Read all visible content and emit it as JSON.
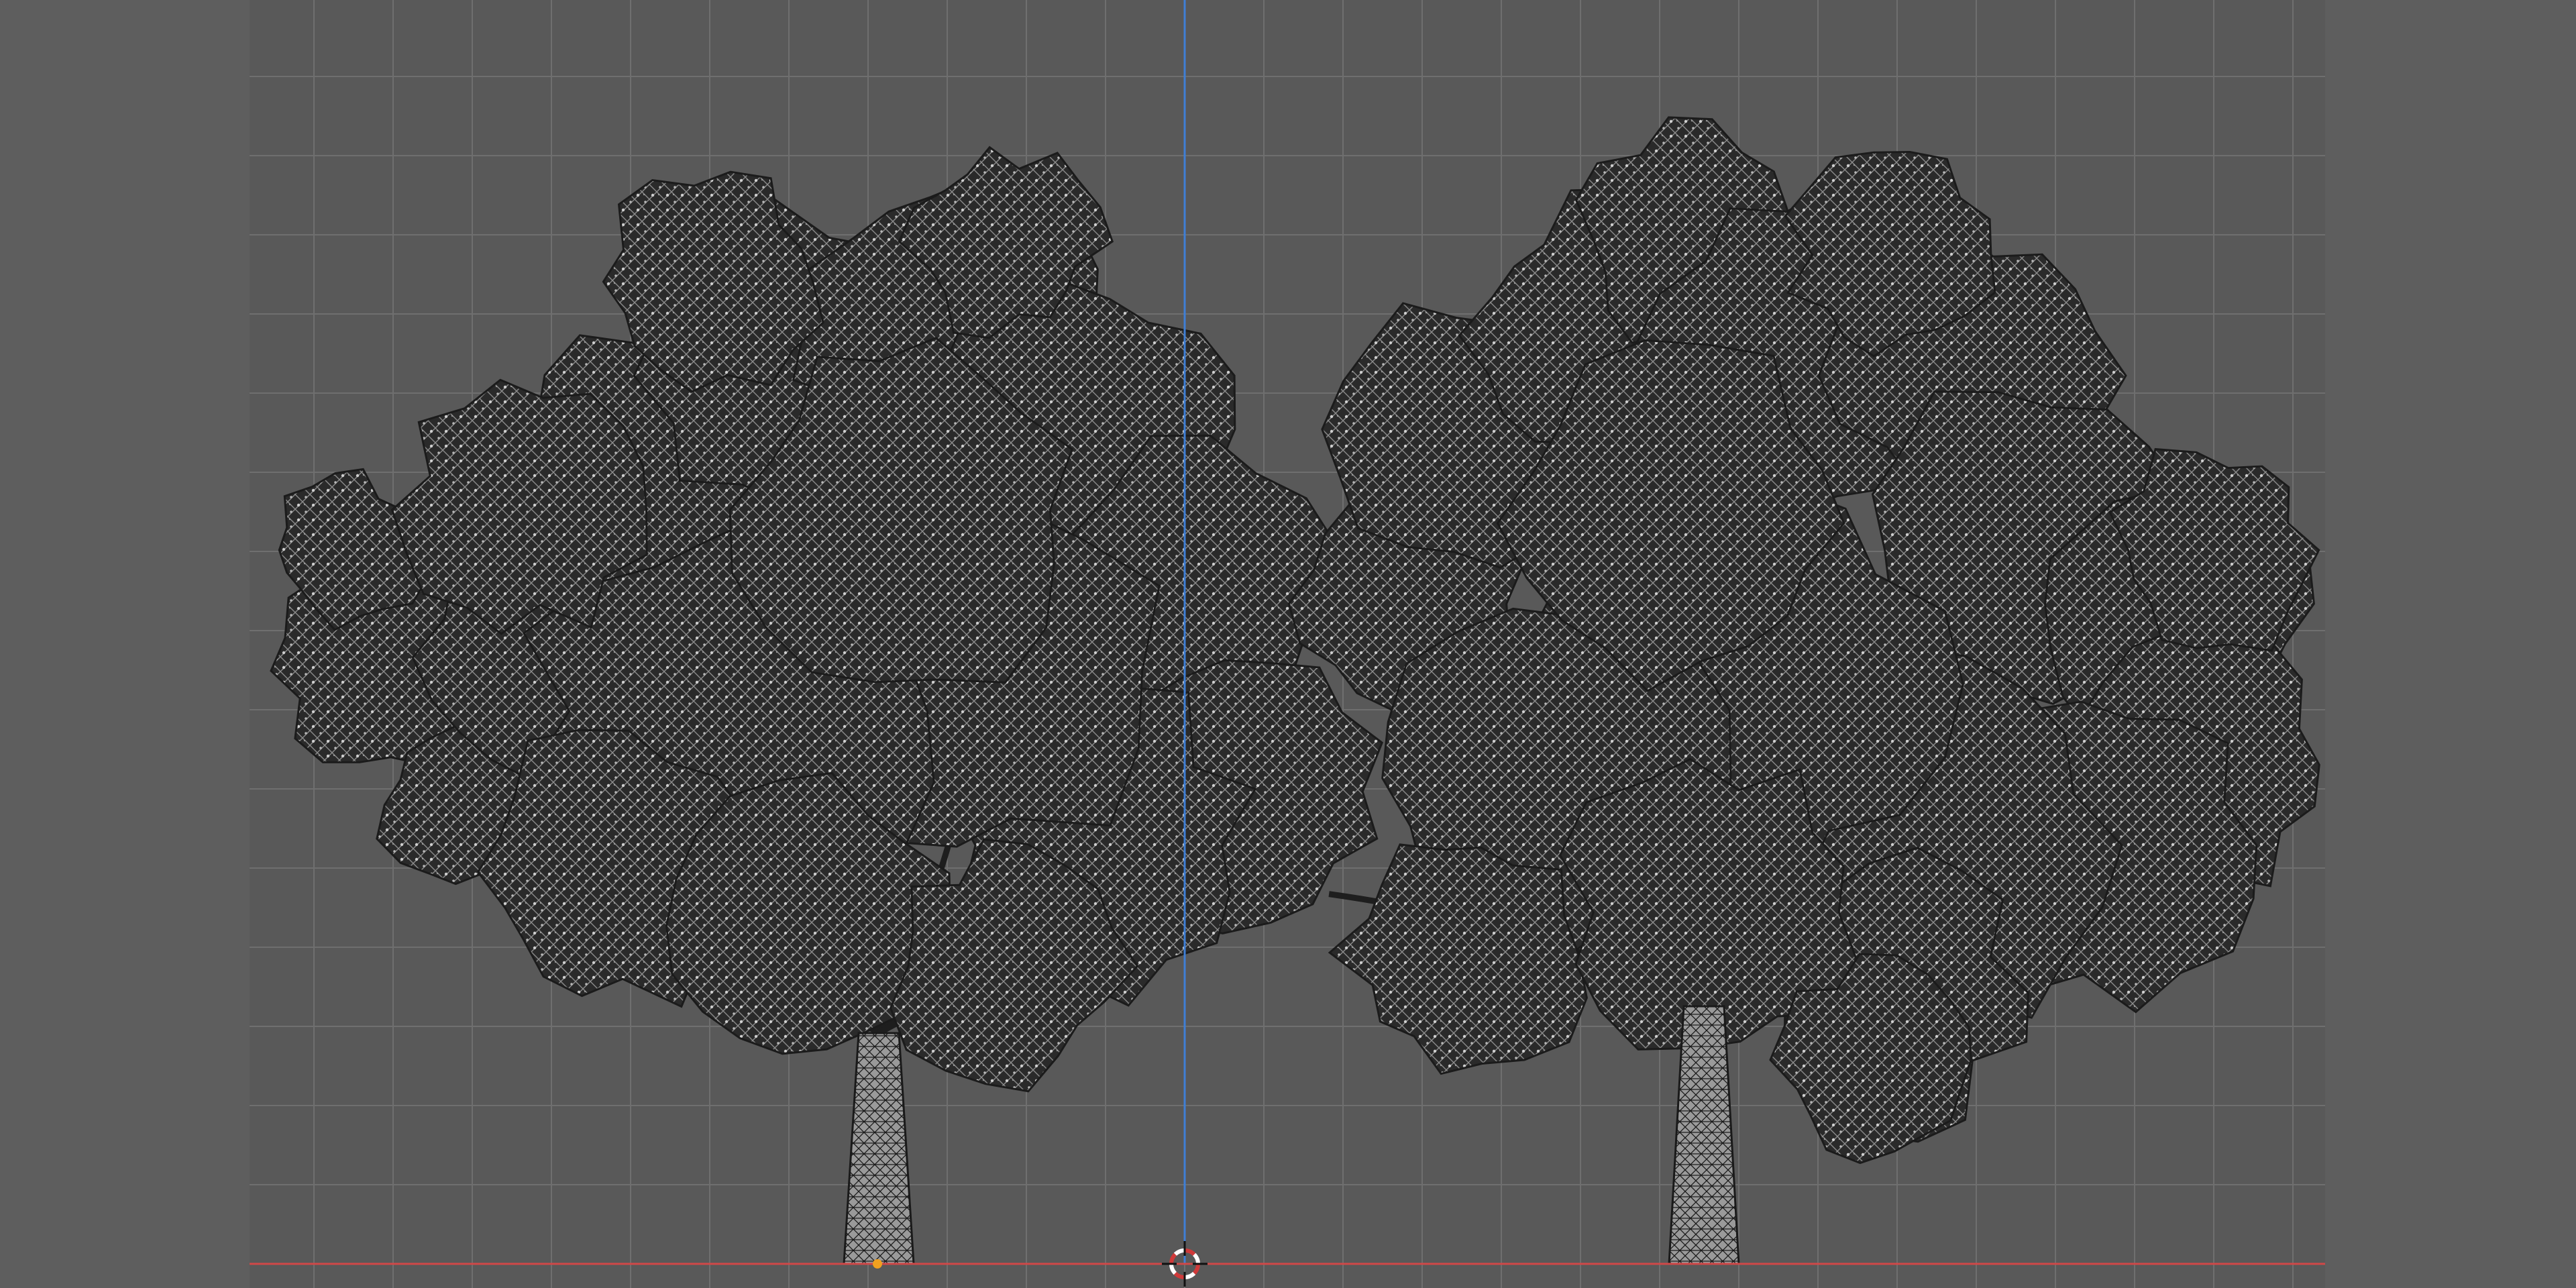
{
  "viewport": {
    "view": "orthographic-front",
    "shading": "wireframe",
    "colors": {
      "background": "#595959",
      "grid_line": "#6f6f6f",
      "grid_line_major": "#7a7a7a",
      "x_axis": "#d04848",
      "z_axis": "#3f7fd6",
      "wire": "#101010",
      "wire_light": "#bdbdbd",
      "cursor_ring_red": "#d03a3a",
      "cursor_ring_white": "#ffffff",
      "origin_dot": "#f0a020"
    }
  },
  "scene": {
    "objects": [
      {
        "name": "tree-left",
        "type": "tree-mesh"
      },
      {
        "name": "tree-right",
        "type": "tree-mesh"
      }
    ],
    "cursor": {
      "icon": "3d-cursor-icon"
    }
  }
}
